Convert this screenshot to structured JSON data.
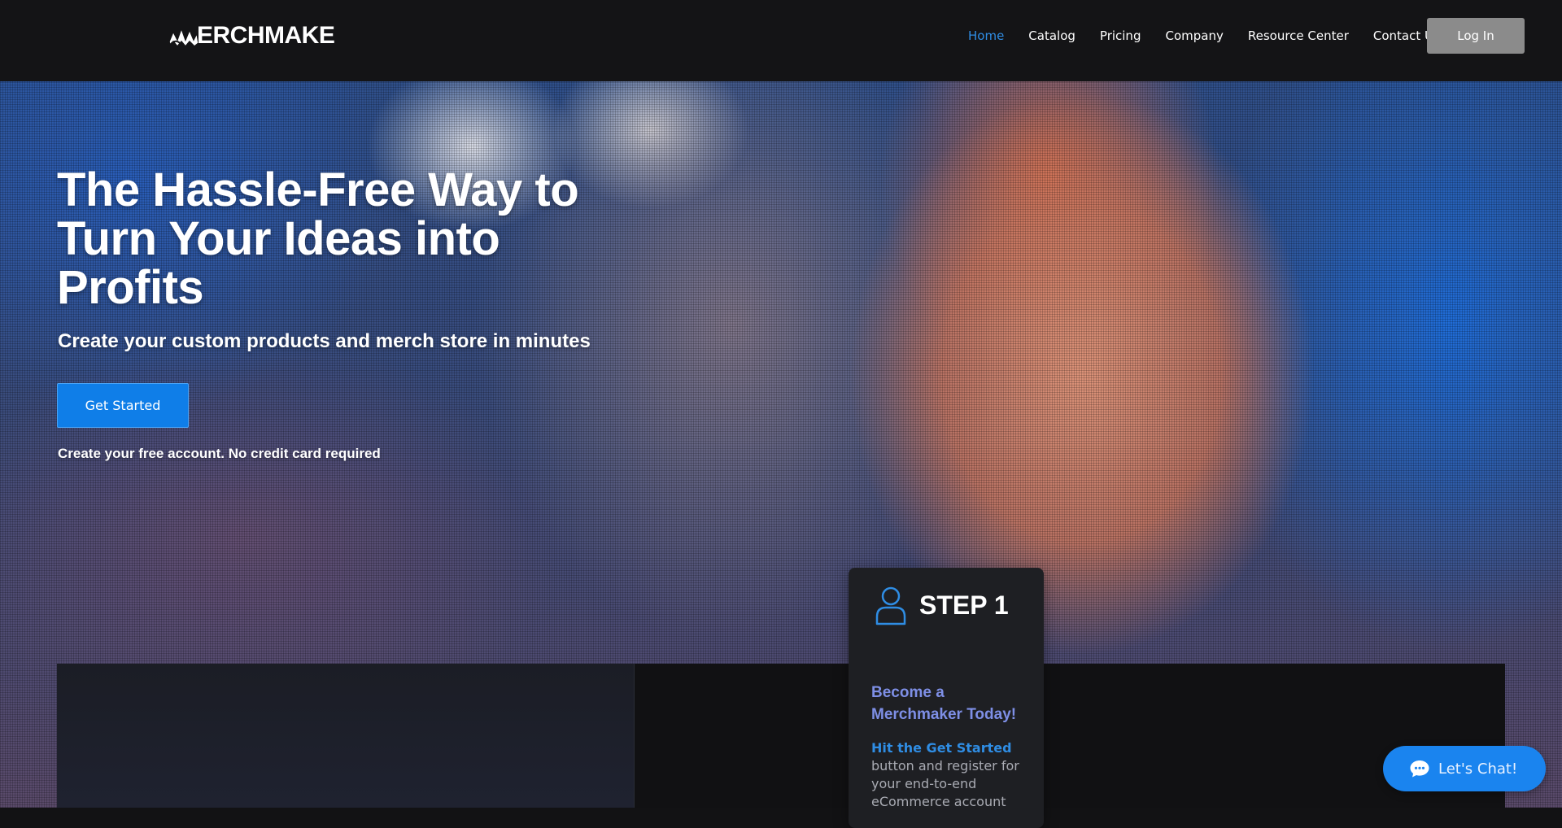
{
  "header": {
    "logo_text": "ERCHMAKE",
    "nav": [
      {
        "label": "Home",
        "active": true
      },
      {
        "label": "Catalog"
      },
      {
        "label": "Pricing"
      },
      {
        "label": "Company"
      },
      {
        "label": "Resource Center"
      },
      {
        "label": "Contact Us"
      }
    ],
    "login_label": "Log In"
  },
  "hero": {
    "title": "The Hassle-Free Way to Turn Your Ideas into Profits",
    "subtitle": "Create your custom products and merch store in minutes",
    "cta_label": "Get Started",
    "note": "Create your free account. No credit card required"
  },
  "step_card": {
    "icon": "user-icon",
    "title": "STEP 1",
    "heading": "Become a Merchmaker Today!",
    "body_highlight": "Hit the Get Started",
    "body_text": "button and register for your end-to-end eCommerce account"
  },
  "chat": {
    "icon": "chat-bubble-icon",
    "label": "Let's Chat!"
  },
  "colors": {
    "accent": "#2f8de4",
    "cta": "#0f7ee8",
    "step_heading": "#7e8fe6",
    "login_button": "#8b8b8b"
  }
}
